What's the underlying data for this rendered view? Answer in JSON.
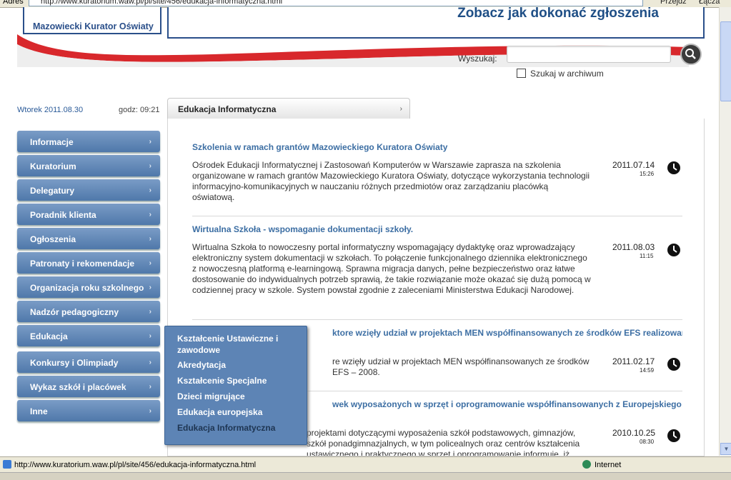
{
  "browser": {
    "address_label": "Adres",
    "url": "http://www.kuratorium.waw.pl/pl/site/456/edukacja-informatyczna.html",
    "go_label": "Przejdź",
    "links_label": "Łącza",
    "status_url": "http://www.kuratorium.waw.pl/pl/site/456/edukacja-informatyczna.html",
    "zone": "Internet"
  },
  "header": {
    "logo_text": "Mazowiecki Kurator Oświaty",
    "banner_text": "Zobacz jak dokonać zgłoszenia",
    "search_label": "Wyszukaj:",
    "search_value": "",
    "archive_label": "Szukaj w archiwum"
  },
  "datebar": {
    "date": "Wtorek 2011.08.30",
    "time": "godz: 09:21"
  },
  "sidebar": {
    "items": [
      {
        "label": "Informacje"
      },
      {
        "label": "Kuratorium"
      },
      {
        "label": "Delegatury"
      },
      {
        "label": "Poradnik klienta"
      },
      {
        "label": "Ogłoszenia"
      },
      {
        "label": "Patronaty i rekomendacje"
      },
      {
        "label": "Organizacja roku szkolnego"
      },
      {
        "label": "Nadzór pedagogiczny"
      },
      {
        "label": "Edukacja"
      },
      {
        "label": "Konkursy i Olimpiady"
      },
      {
        "label": "Wykaz szkół i placówek"
      },
      {
        "label": "Inne"
      }
    ]
  },
  "dropdown": {
    "items": [
      {
        "label": "Kształcenie Ustawiczne i zawodowe"
      },
      {
        "label": "Akredytacja"
      },
      {
        "label": "Kształcenie Specjalne"
      },
      {
        "label": "Dzieci migrujące"
      },
      {
        "label": "Edukacja europejska"
      },
      {
        "label": "Edukacja Informatyczna"
      }
    ]
  },
  "main": {
    "tab_title": "Edukacja Informatyczna",
    "articles": [
      {
        "title": "Szkolenia w ramach grantów Mazowieckiego Kuratora Oświaty",
        "body": "Ośrodek Edukacji Informatycznej i Zastosowań Komputerów w Warszawie zaprasza na szkolenia organizowane w ramach grantów Mazowieckiego Kuratora Oświaty, dotyczące wykorzystania technologii informacyjno-komunikacyjnych w nauczaniu różnych przedmiotów oraz zarządzaniu placówką oświatową.",
        "date": "2011.07.14",
        "hour": "15:26"
      },
      {
        "title": "Wirtualna Szkoła - wspomaganie dokumentacji szkoły.",
        "body": "Wirtualna Szkoła to nowoczesny portal informatyczny wspomagający dydaktykę oraz wprowadzający elektroniczny system dokumentacji w szkołach. To połączenie funkcjonalnego dziennika elektronicznego z nowoczesną platformą e-learningową. Sprawna migracja danych, pełne bezpieczeństwo oraz łatwe dostosowanie do indywidualnych potrzeb sprawią, że takie rozwiązanie może okazać się dużą pomocą w codziennej pracy w szkole. System powstał zgodnie z zaleceniami Ministerstwa Edukacji Narodowej.",
        "date": "2011.08.03",
        "hour": "11:15"
      },
      {
        "title": "ktore wzięły udział w projektach MEN współfinansowanych ze środków EFS realizowanych w",
        "body": "re wzięły udział w projektach MEN współfinansowanych ze środków EFS – 2008.",
        "date": "2011.02.17",
        "hour": "14:59"
      },
      {
        "title": "wek wyposażonych w sprzęt i oprogramowanie współfinansowanych z Europejskiego",
        "body": "projektami dotyczącymi wyposażenia szkół podstawowych, gimnazjów, szkół ponadgimnazjalnych, w tym policealnych oraz centrów kształcenia ustawicznego i praktycznego w sprzęt i oprogramowanie informuje, iż",
        "date": "2010.10.25",
        "hour": "08:30"
      }
    ]
  }
}
